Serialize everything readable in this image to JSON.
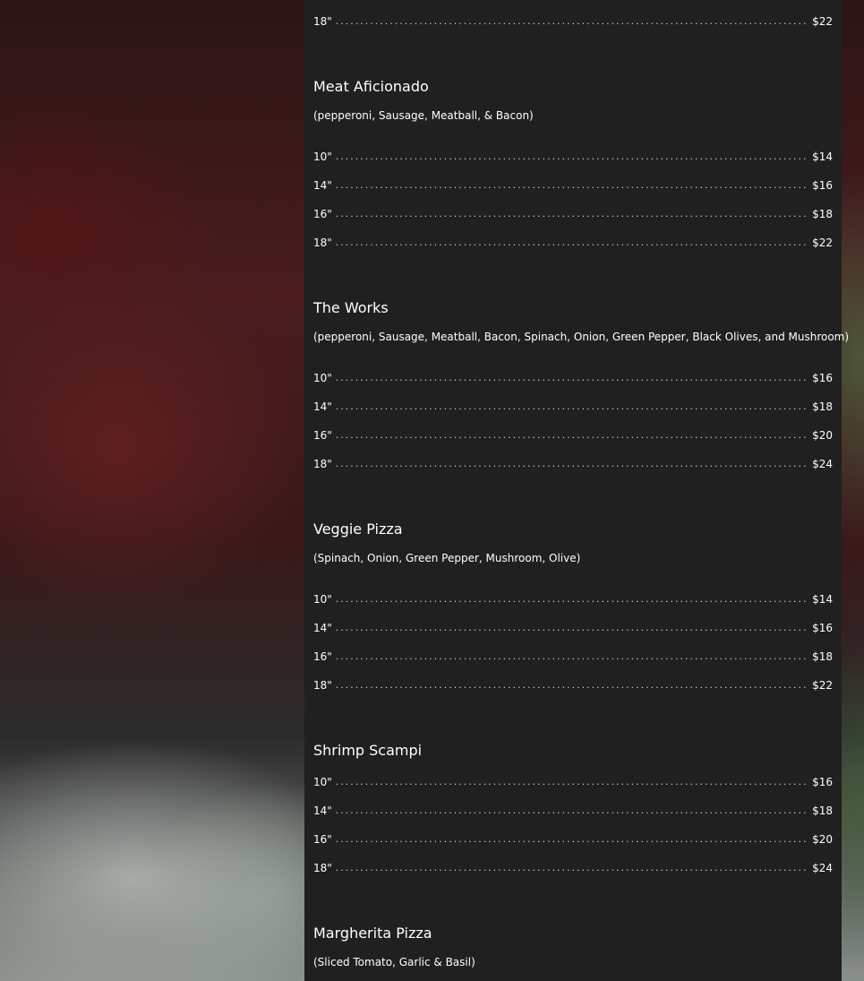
{
  "menu": {
    "top_fragment": {
      "rows": [
        {
          "size": "18\"",
          "price": "$22"
        }
      ]
    },
    "items": [
      {
        "title": "Meat Aficionado",
        "description": "(pepperoni, Sausage, Meatball, & Bacon)",
        "rows": [
          {
            "size": "10\"",
            "price": "$14"
          },
          {
            "size": "14\"",
            "price": "$16"
          },
          {
            "size": "16\"",
            "price": "$18"
          },
          {
            "size": "18\"",
            "price": "$22"
          }
        ]
      },
      {
        "title": "The Works",
        "description": "(pepperoni, Sausage, Meatball, Bacon, Spinach, Onion, Green Pepper, Black Olives, and Mushroom)",
        "rows": [
          {
            "size": "10\"",
            "price": "$16"
          },
          {
            "size": "14\"",
            "price": "$18"
          },
          {
            "size": "16\"",
            "price": "$20"
          },
          {
            "size": "18\"",
            "price": "$24"
          }
        ]
      },
      {
        "title": "Veggie Pizza",
        "description": "(Spinach, Onion, Green Pepper, Mushroom, Olive)",
        "rows": [
          {
            "size": "10\"",
            "price": "$14"
          },
          {
            "size": "14\"",
            "price": "$16"
          },
          {
            "size": "16\"",
            "price": "$18"
          },
          {
            "size": "18\"",
            "price": "$22"
          }
        ]
      },
      {
        "title": "Shrimp Scampi",
        "description": "",
        "rows": [
          {
            "size": "10\"",
            "price": "$16"
          },
          {
            "size": "14\"",
            "price": "$18"
          },
          {
            "size": "16\"",
            "price": "$20"
          },
          {
            "size": "18\"",
            "price": "$24"
          }
        ]
      },
      {
        "title": "Margherita Pizza",
        "description": "(Sliced Tomato, Garlic & Basil)",
        "rows": []
      }
    ]
  },
  "colors": {
    "panel_background": "#202020",
    "text": "#ffffff"
  }
}
